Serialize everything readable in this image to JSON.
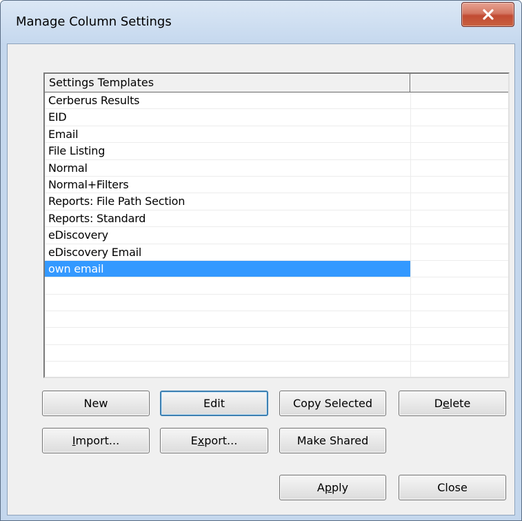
{
  "window": {
    "title": "Manage Column Settings"
  },
  "list": {
    "columns": [
      "Settings Templates",
      ""
    ],
    "rows": [
      "Cerberus Results",
      "EID",
      "Email",
      "File Listing",
      "Normal",
      "Normal+Filters",
      "Reports: File Path Section",
      "Reports: Standard",
      "eDiscovery",
      "eDiscovery Email",
      "own email",
      "",
      "",
      "",
      "",
      "",
      ""
    ],
    "selected_index": 10
  },
  "buttons": {
    "new": "New",
    "edit": "Edit",
    "copy_selected": "Copy Selected",
    "delete": {
      "pre": "D",
      "u": "e",
      "post": "lete"
    },
    "import": {
      "pre": "",
      "u": "I",
      "post": "mport..."
    },
    "export": {
      "pre": "E",
      "u": "x",
      "post": "port..."
    },
    "make_shared": "Make Shared",
    "apply": {
      "pre": "A",
      "u": "p",
      "post": "ply"
    },
    "close": "Close"
  },
  "icons": {
    "close": "close-x-icon"
  },
  "colors": {
    "selection": "#3399ff",
    "close_button": "#c24b33",
    "default_button_border": "#3c7fb1"
  }
}
